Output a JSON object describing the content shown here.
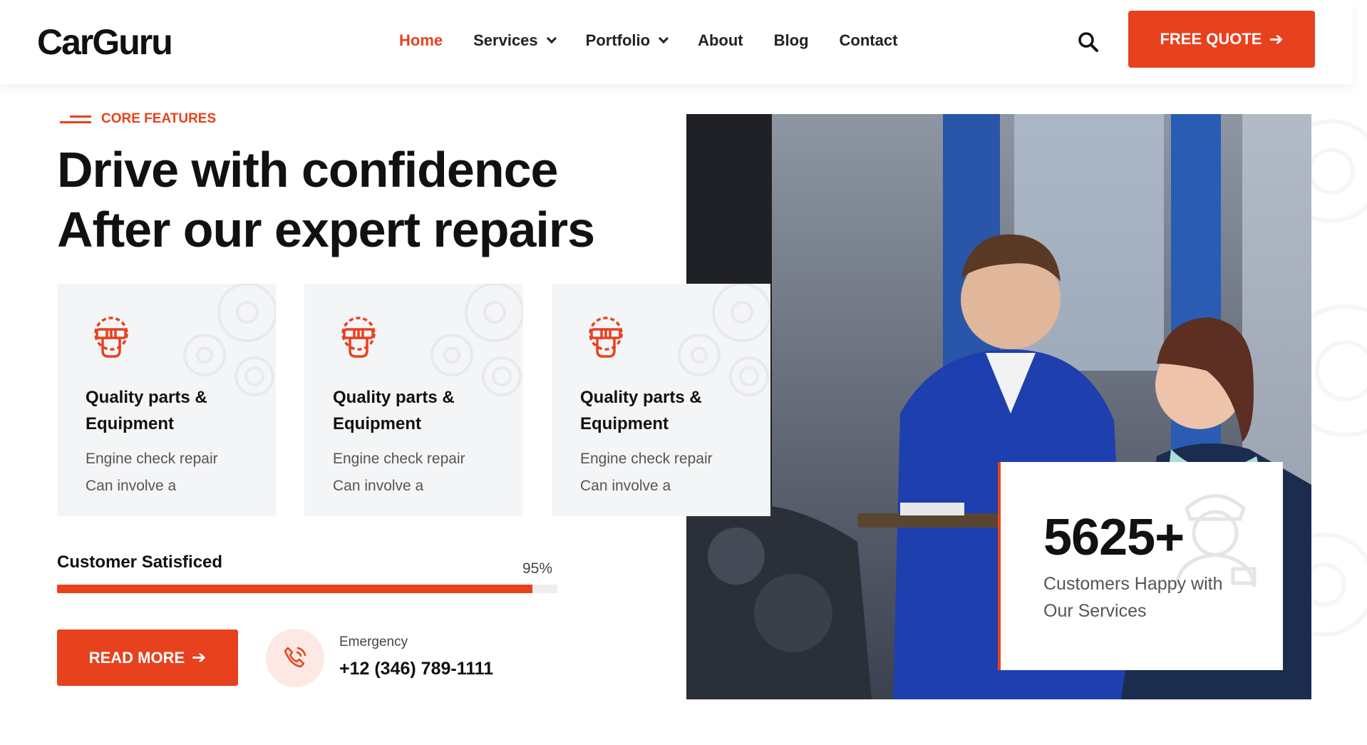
{
  "brand": {
    "logo": "CarGuru",
    "accent": "#e8411d"
  },
  "nav": {
    "items": [
      {
        "label": "Home",
        "active": true,
        "dropdown": false
      },
      {
        "label": "Services",
        "active": false,
        "dropdown": true
      },
      {
        "label": "Portfolio",
        "active": false,
        "dropdown": true
      },
      {
        "label": "About",
        "active": false,
        "dropdown": false
      },
      {
        "label": "Blog",
        "active": false,
        "dropdown": false
      },
      {
        "label": "Contact",
        "active": false,
        "dropdown": false
      }
    ],
    "search_icon": "search-icon",
    "cta_label": "FREE QUOTE",
    "cta_icon": "arrow-right-icon"
  },
  "hero": {
    "eyebrow": "CORE FEATURES",
    "headline_line1": "Drive with confidence",
    "headline_line2": "After our expert repairs"
  },
  "features": [
    {
      "icon": "wrench-fist-icon",
      "title": "Quality parts & Equipment",
      "desc_line1": "Engine check repair",
      "desc_line2": "Can involve a"
    },
    {
      "icon": "wrench-fist-icon",
      "title": "Quality parts & Equipment",
      "desc_line1": "Engine check repair",
      "desc_line2": "Can involve a"
    },
    {
      "icon": "wrench-fist-icon",
      "title": "Quality parts & Equipment",
      "desc_line1": "Engine check repair",
      "desc_line2": "Can involve a"
    }
  ],
  "progress": {
    "label": "Customer Satisficed",
    "value_text": "95%",
    "percent": 95
  },
  "actions": {
    "read_more": "READ MORE",
    "emergency_label": "Emergency",
    "emergency_phone": "+12 (346) 789-1111",
    "phone_icon": "phone-ring-icon"
  },
  "stat": {
    "number": "5625+",
    "text_line1": "Customers Happy with",
    "text_line2": "Our Services"
  },
  "photo": {
    "subject": "mechanic-and-customer-photo"
  }
}
